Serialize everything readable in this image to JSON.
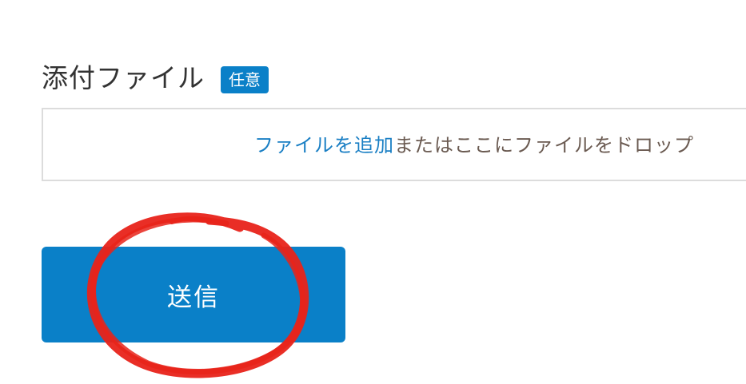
{
  "attachment": {
    "label": "添付ファイル",
    "badge": "任意",
    "dropzone": {
      "add_link": "ファイルを追加",
      "hint": "またはここにファイルをドロップ"
    }
  },
  "form": {
    "submit_label": "送信"
  },
  "colors": {
    "accent": "#0a80c8",
    "link": "#1a7fc4",
    "annotation": "#e8231a"
  }
}
